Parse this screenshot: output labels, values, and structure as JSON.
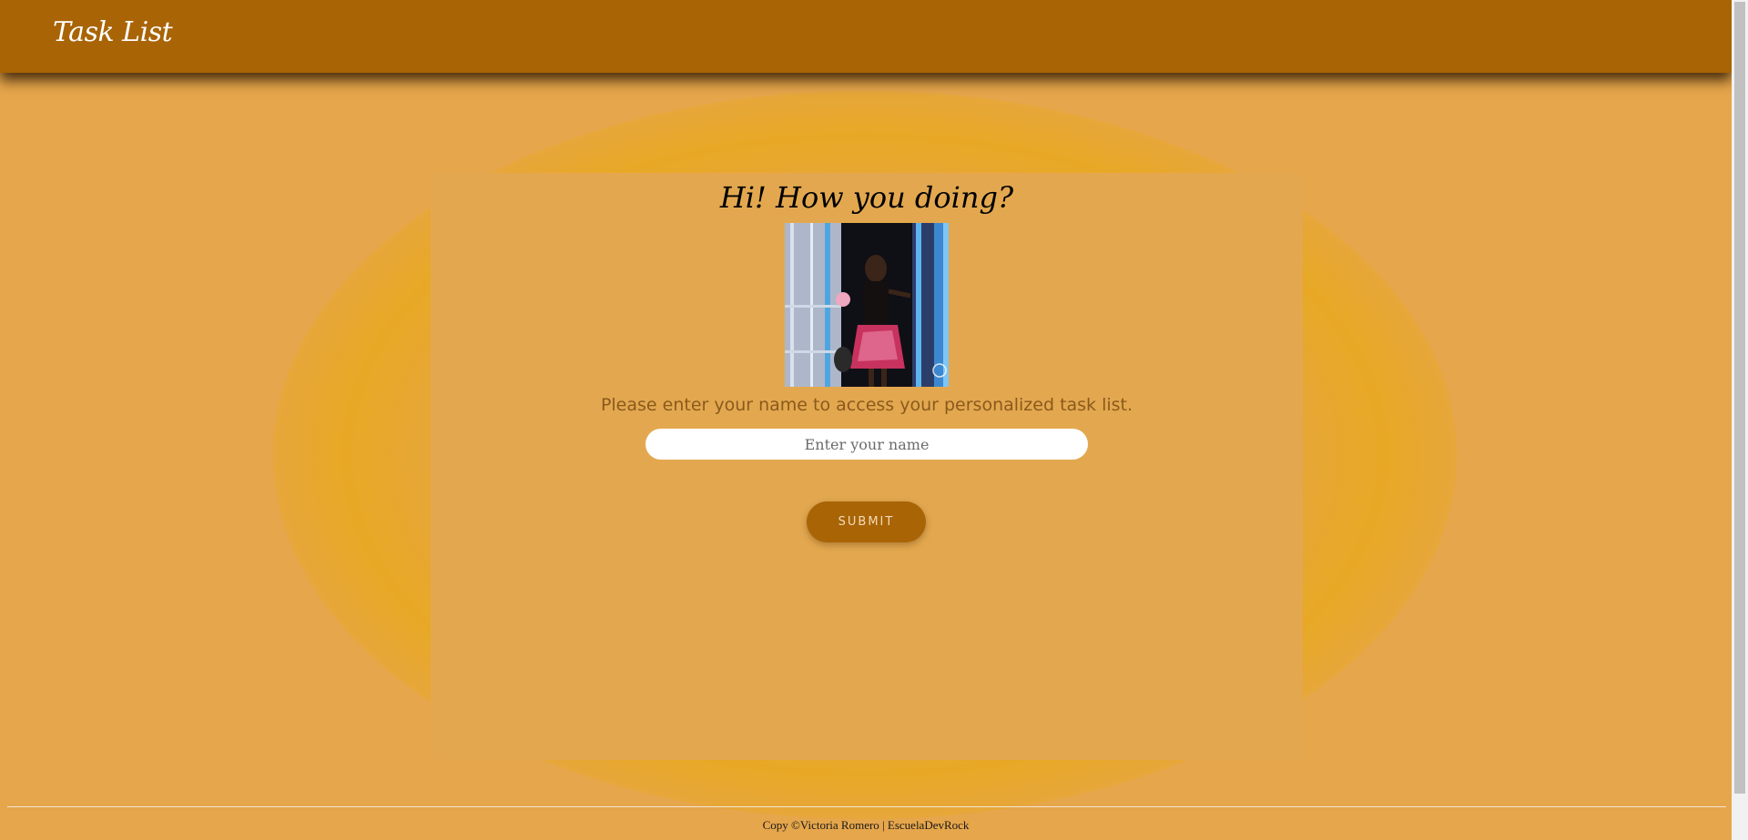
{
  "header": {
    "brand": "Task List"
  },
  "welcome": {
    "greeting": "Hi! How you doing?",
    "image_alt": "woman entering through a door",
    "instructions": "Please enter your name to access your personalized task list."
  },
  "form": {
    "name_placeholder": "Enter your name",
    "name_value": "",
    "submit_label": "SUBMIT"
  },
  "footer": {
    "text": "Copy ©Victoria Romero | EscuelaDevRock"
  },
  "colors": {
    "header": "#a96406",
    "page_background": "#e6a64b",
    "card_background": "#e3a84f",
    "button": "#a96406"
  }
}
